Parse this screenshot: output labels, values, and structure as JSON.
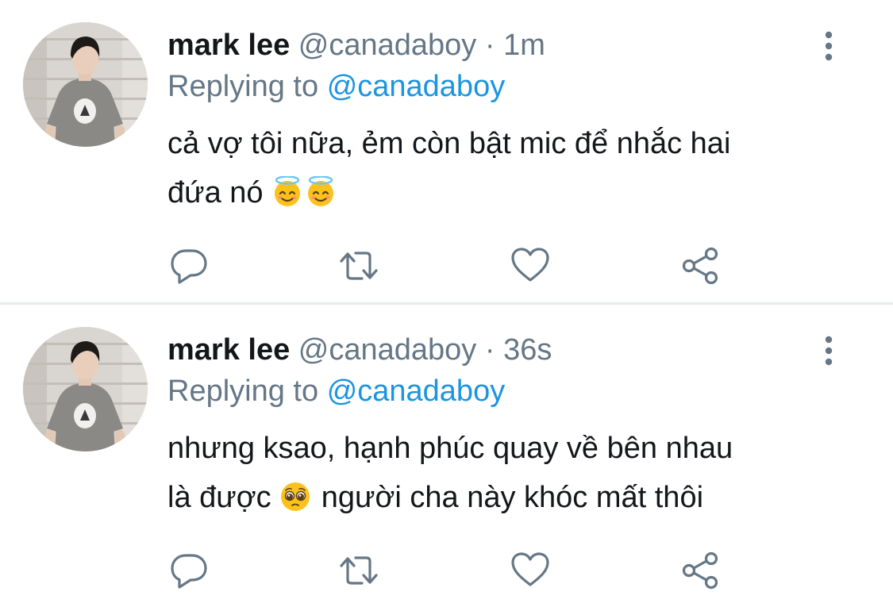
{
  "colors": {
    "text_primary": "#14171a",
    "text_secondary": "#657786",
    "link": "#1b95e0",
    "icon": "#657786",
    "divider": "#e6ecf0"
  },
  "tweets": [
    {
      "display_name": "mark lee",
      "handle": "@canadaboy",
      "separator": "·",
      "time": "1m",
      "reply_prefix": "Replying to",
      "reply_to": "@canadaboy",
      "text_line1": "cả vợ tôi nữa, ẻm còn bật mic để nhắc hai",
      "text_line2": "đứa nó",
      "emojis": [
        "smiling-face-with-halo",
        "smiling-face-with-halo"
      ],
      "actions": [
        "reply-icon",
        "retweet-icon",
        "like-icon",
        "share-icon"
      ]
    },
    {
      "display_name": "mark lee",
      "handle": "@canadaboy",
      "separator": "·",
      "time": "36s",
      "reply_prefix": "Replying to",
      "reply_to": "@canadaboy",
      "text_line1": "nhưng ksao, hạnh phúc quay về bên nhau",
      "text_line2a": "là được",
      "text_line2b": "người cha này khóc mất thôi",
      "emojis": [
        "pleading-face"
      ],
      "actions": [
        "reply-icon",
        "retweet-icon",
        "like-icon",
        "share-icon"
      ]
    }
  ]
}
